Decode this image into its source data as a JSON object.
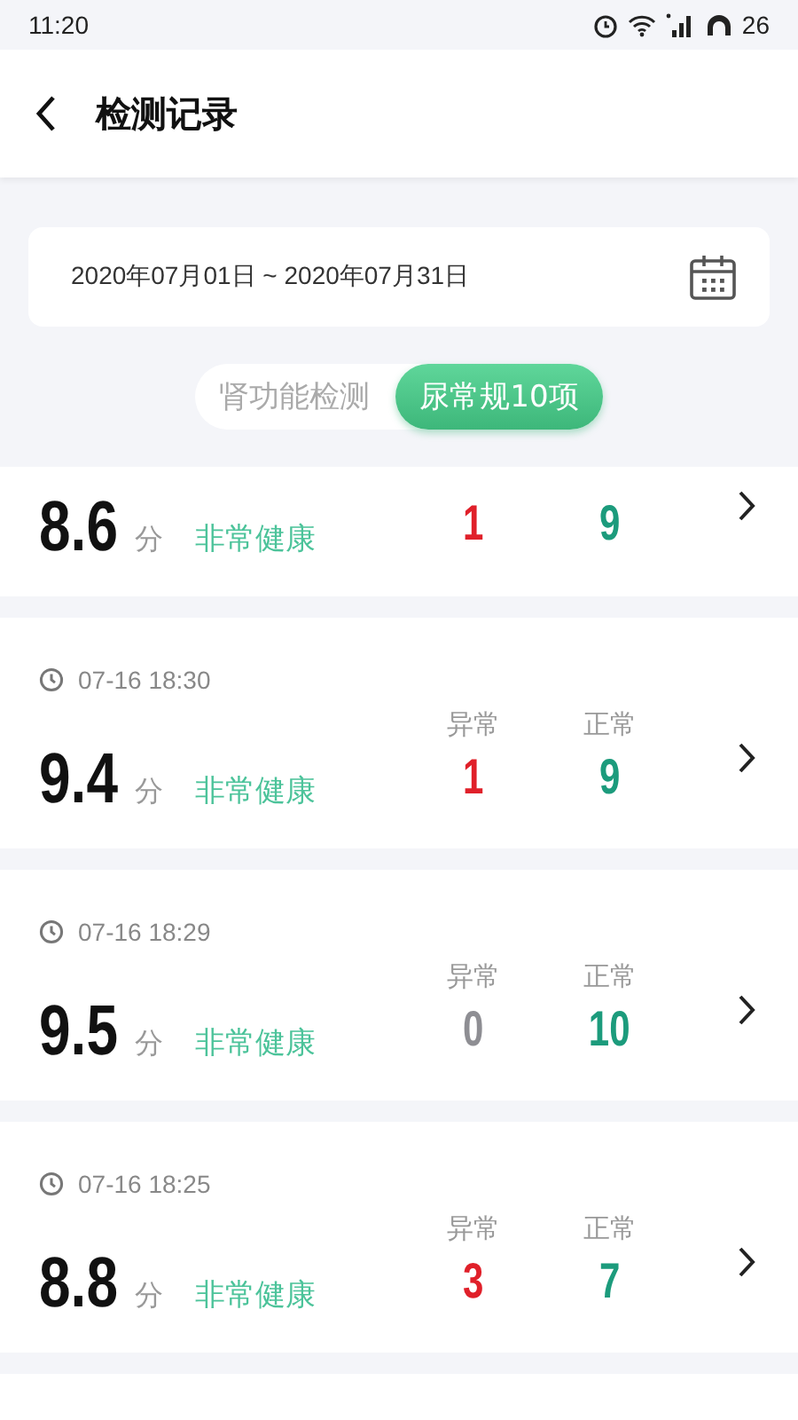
{
  "status_bar": {
    "time": "11:20",
    "battery": "26"
  },
  "header": {
    "title": "检测记录"
  },
  "date_range": {
    "value": "2020年07月01日 ~ 2020年07月31日"
  },
  "tabs": [
    {
      "label": "肾功能检测",
      "selected": false
    },
    {
      "label": "尿常规10项",
      "selected": true
    }
  ],
  "records": [
    {
      "kind": "record",
      "score": "8.6",
      "unit": "分",
      "status": "非常健康",
      "abnormal": "1",
      "abnormal_alert": true,
      "normal": "9"
    },
    {
      "kind": "record",
      "time": "07-16 18:30",
      "score": "9.4",
      "unit": "分",
      "status": "非常健康",
      "abnormal_label": "异常",
      "abnormal": "1",
      "abnormal_alert": true,
      "normal_label": "正常",
      "normal": "9"
    },
    {
      "kind": "record",
      "time": "07-16 18:29",
      "score": "9.5",
      "unit": "分",
      "status": "非常健康",
      "abnormal_label": "异常",
      "abnormal": "0",
      "abnormal_alert": false,
      "normal_label": "正常",
      "normal": "10"
    },
    {
      "kind": "record",
      "time": "07-16 18:25",
      "score": "8.8",
      "unit": "分",
      "status": "非常健康",
      "abnormal_label": "异常",
      "abnormal": "3",
      "abnormal_alert": true,
      "normal_label": "正常",
      "normal": "7"
    },
    {
      "kind": "partial"
    }
  ]
}
